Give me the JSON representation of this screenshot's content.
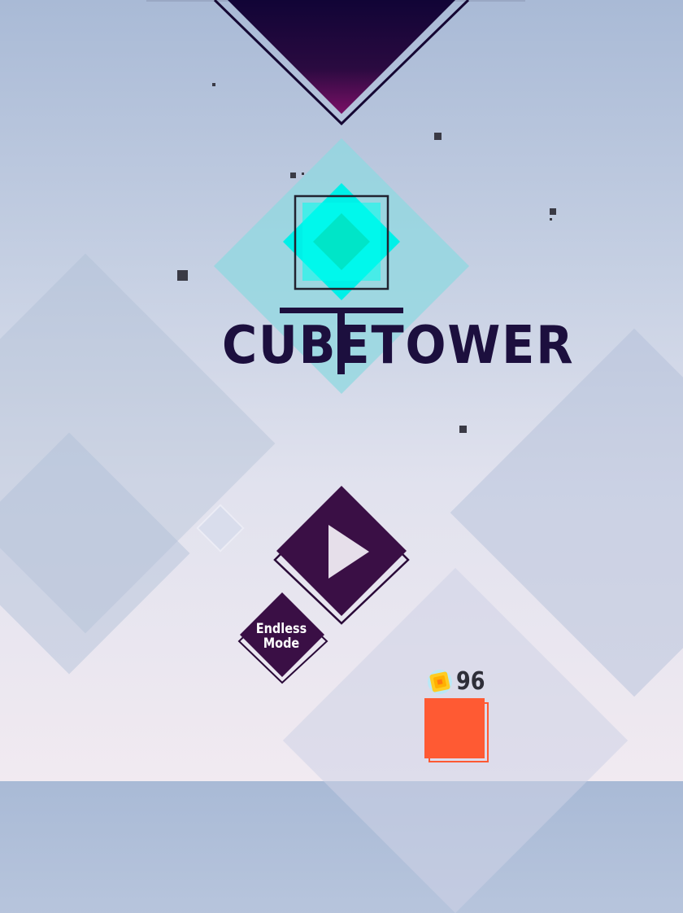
{
  "game": {
    "title": "CUBETOWER",
    "play_label": "Play",
    "endless_mode_line1": "Endless",
    "endless_mode_line2": "Mode",
    "coin_count": "96"
  },
  "colors": {
    "background_top": "#a9bad6",
    "background_bottom": "#f1eaf1",
    "logo_dark": "#1c0f3e",
    "cyan": "#00f0e8",
    "button_purple": "#3a0f45",
    "orange": "#ff5a33",
    "coin_yellow": "#ffcc22"
  },
  "icons": {
    "play": "play-triangle-icon",
    "coin": "coin-cube-icon"
  }
}
